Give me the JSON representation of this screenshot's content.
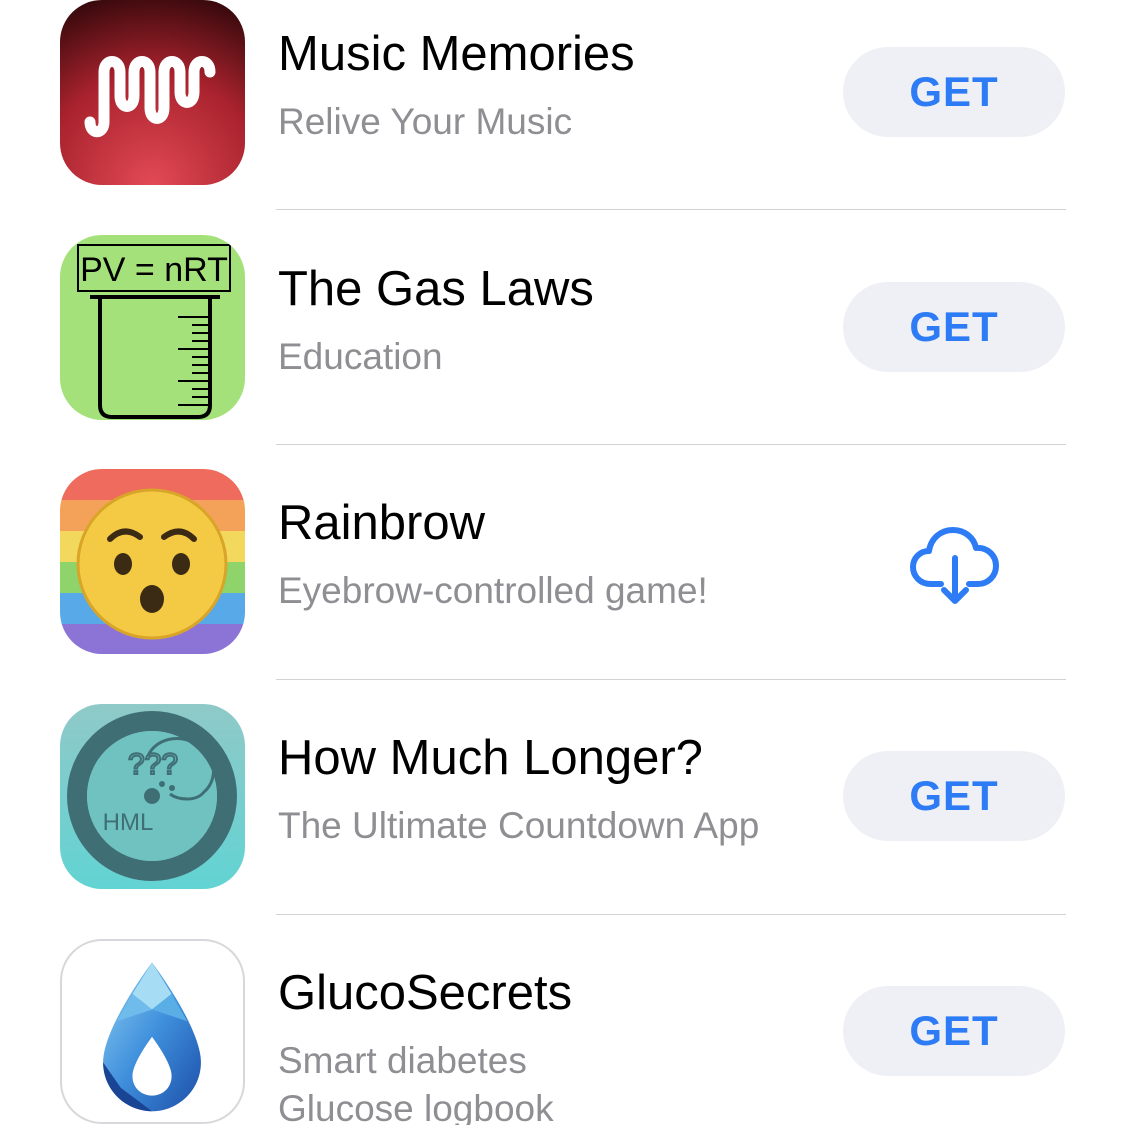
{
  "apps": [
    {
      "title": "Music Memories",
      "subtitle": "Relive Your Music",
      "action": "GET",
      "icon": "music-memories-wave-icon"
    },
    {
      "title": "The Gas Laws",
      "subtitle": "Education",
      "action": "GET",
      "icon": "gas-laws-beaker-icon",
      "icon_text": "PV = nRT"
    },
    {
      "title": "Rainbrow",
      "subtitle": "Eyebrow-controlled game!",
      "action": "download",
      "icon": "rainbrow-surprised-face-icon"
    },
    {
      "title": "How Much Longer?",
      "subtitle": "The Ultimate Countdown App",
      "action": "GET",
      "icon": "how-much-longer-brain-icon",
      "icon_text": "HML"
    },
    {
      "title": "GlucoSecrets",
      "subtitle": "Smart diabetes",
      "subtitle_line2": "Glucose logbook",
      "action": "GET",
      "icon": "glucosecrets-drop-icon"
    }
  ],
  "colors": {
    "accent": "#2d7cf6",
    "button_bg": "#eff0f5",
    "subtitle": "#8e8e93",
    "separator": "#d1d1d6"
  },
  "download_icon": "cloud-download-icon"
}
